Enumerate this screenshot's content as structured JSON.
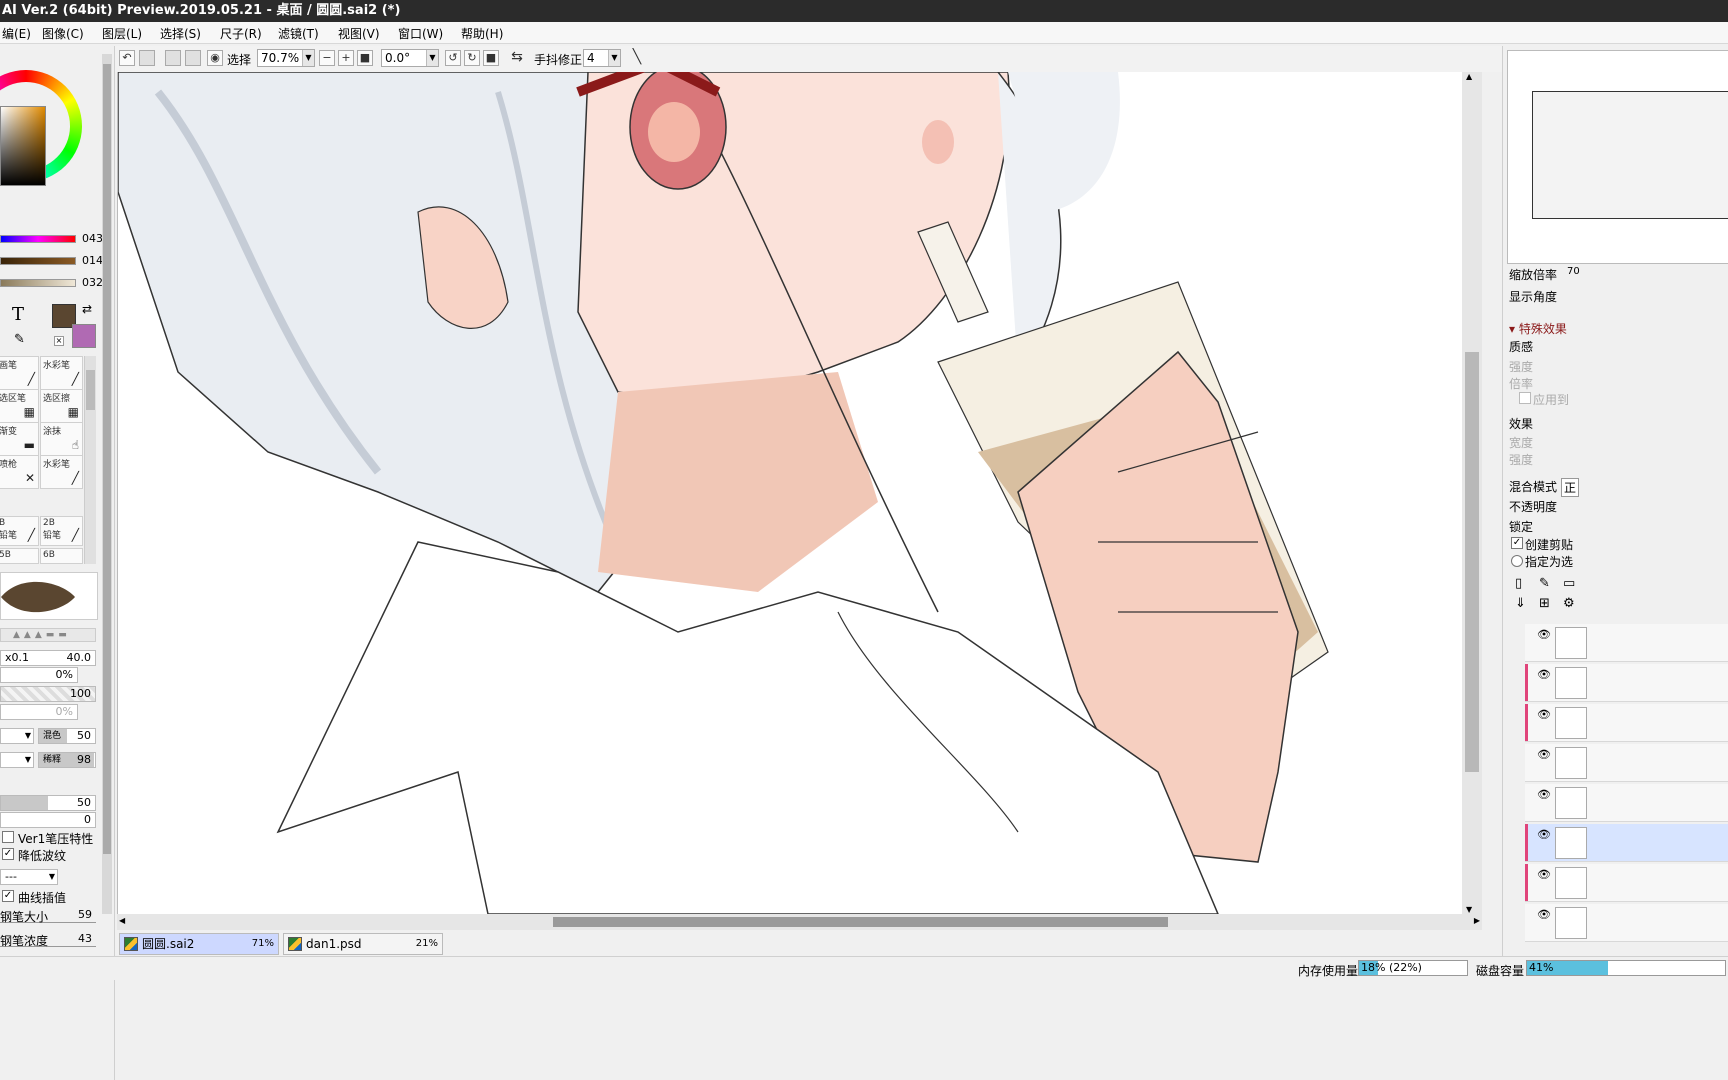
{
  "window": {
    "title": "AI Ver.2 (64bit) Preview.2019.05.21 - 桌面 / 圆圆.sai2 (*)"
  },
  "menu": {
    "items": [
      "编(E)",
      "图像(C)",
      "图层(L)",
      "选择(S)",
      "尺子(R)",
      "滤镜(T)",
      "视图(V)",
      "窗口(W)",
      "帮助(H)"
    ]
  },
  "toolbar": {
    "select_label": "选择",
    "zoom": "70.7%",
    "angle": "0.0°",
    "stabilizer_label": "手抖修正",
    "stabilizer_value": "4"
  },
  "colors": {
    "primary": "#5a4630",
    "secondary": "#b06ab3",
    "slider_r": "#ff0000",
    "slider_g": "#5c3a1a",
    "slider_b": "#c9b89a"
  },
  "color_sliders": {
    "values": [
      "043",
      "014",
      "032"
    ]
  },
  "tools": {
    "cells": [
      {
        "label": "画笔",
        "icon": "brush-icon"
      },
      {
        "label": "水彩笔",
        "icon": "watercolor-icon"
      },
      {
        "label": "选区笔",
        "icon": "select-pen-icon"
      },
      {
        "label": "选区擦",
        "icon": "select-eraser-icon"
      },
      {
        "label": "渐变",
        "icon": "gradient-icon"
      },
      {
        "label": "涂抹",
        "icon": "smudge-icon"
      },
      {
        "label": "喷枪",
        "icon": "airbrush-icon"
      },
      {
        "label": "水彩笔",
        "icon": "watercolor-icon"
      }
    ],
    "pencils": [
      {
        "label": "B",
        "sub": "铅笔"
      },
      {
        "label": "2B",
        "sub": "铅笔"
      },
      {
        "label": "5B",
        "sub": ""
      },
      {
        "label": "6B",
        "sub": ""
      }
    ]
  },
  "brush_params": {
    "size_mult": "x0.1",
    "size": "40.0",
    "min_size": "0%",
    "density": "100",
    "blank": "0%",
    "blend_label": "混色",
    "blend": "50",
    "dilution_label": "稀释",
    "dilution": "98",
    "persistence": "50",
    "zero": "0",
    "ver1_label": "Ver1笔压特性",
    "moire_label": "降低波纹",
    "dropdown": "---",
    "curve_label": "曲线插值",
    "pen_size_label": "钢笔大小",
    "pen_size": "59",
    "pen_density_label": "钢笔浓度",
    "pen_density": "43"
  },
  "right_panel": {
    "zoom_label": "缩放倍率",
    "zoom_value": "70",
    "angle_label": "显示角度",
    "fx_header": "特殊效果",
    "texture_label": "质感",
    "strength_label": "强度",
    "scale_label": "倍率",
    "apply_label": "应用到",
    "effect_label": "效果",
    "width_label": "宽度",
    "strength2_label": "强度",
    "blend_mode_label": "混合模式",
    "blend_mode_value": "正",
    "opacity_label": "不透明度",
    "lock_label": "锁定",
    "clip_label": "创建剪贴",
    "select_src_label": "指定为选",
    "layer_count": 8
  },
  "doc_tabs": [
    {
      "name": "圆圆.sai2",
      "zoom": "71%"
    },
    {
      "name": "dan1.psd",
      "zoom": "21%"
    }
  ],
  "status": {
    "memory_label": "内存使用量",
    "memory_value": "18% (22%)",
    "memory_fraction": 0.18,
    "disk_label": "磁盘容量",
    "disk_value": "41%",
    "disk_fraction": 0.41
  }
}
